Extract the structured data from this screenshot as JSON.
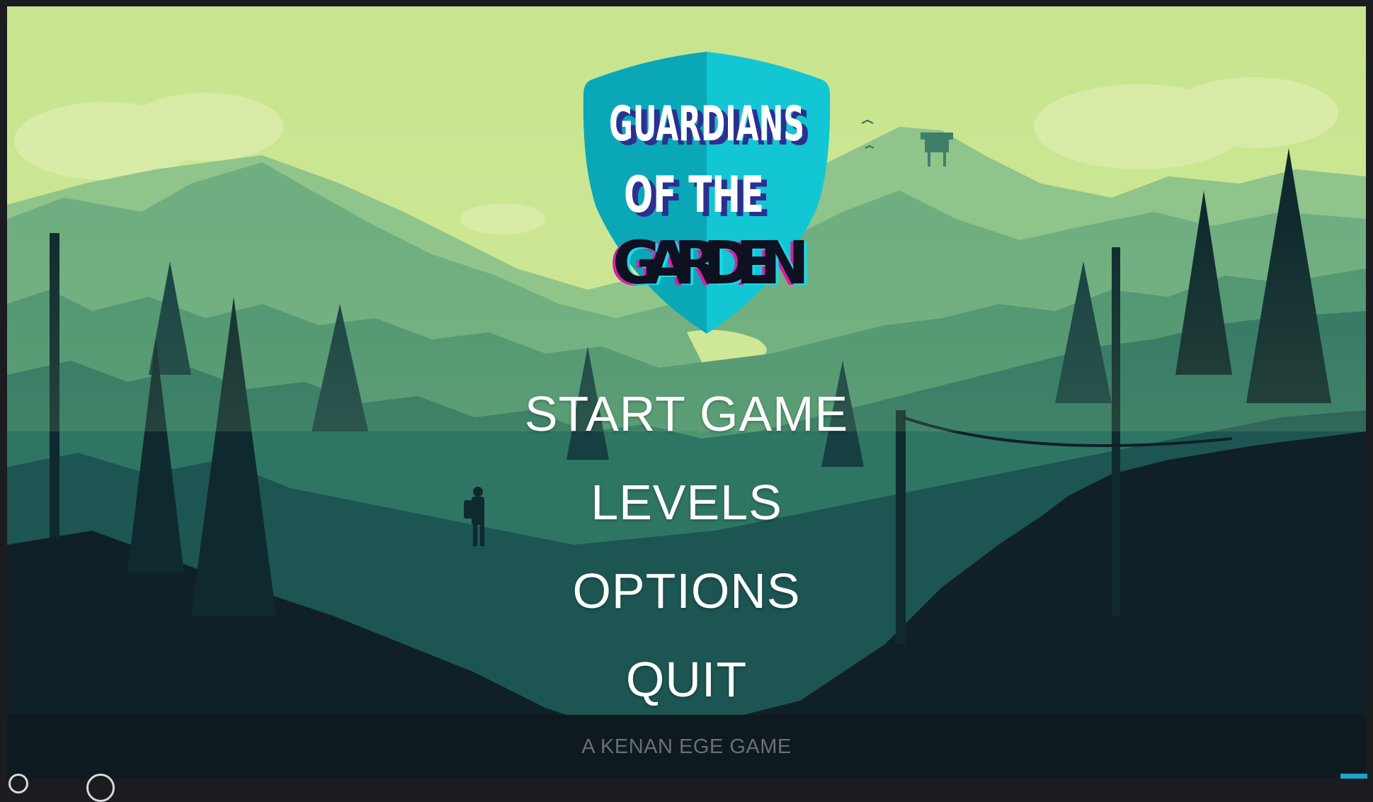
{
  "logo": {
    "line1": "GUARDIANS",
    "line2": "OF THE",
    "line3": "GARDEN",
    "colors": {
      "shield_light": "#12c6d4",
      "shield_dark": "#0aa7b6",
      "title_fill": "#ffffff",
      "accent_shadow": "#2c2f8f",
      "garden_fill": "#0f1020",
      "garden_magenta": "#d61fa8",
      "garden_cyan": "#19d8e8"
    }
  },
  "menu": {
    "items": [
      {
        "id": "start",
        "label": "START GAME"
      },
      {
        "id": "levels",
        "label": "LEVELS"
      },
      {
        "id": "options",
        "label": "OPTIONS"
      },
      {
        "id": "quit",
        "label": "QUIT"
      }
    ]
  },
  "footer": {
    "credit": "A KENAN EGE GAME"
  },
  "theme": {
    "sky": "#c9e58f",
    "frame": "#1a1c1f",
    "text": "#ffffff",
    "credit_text": "#6a6f72",
    "corner_accent": "#1fa3c7"
  }
}
